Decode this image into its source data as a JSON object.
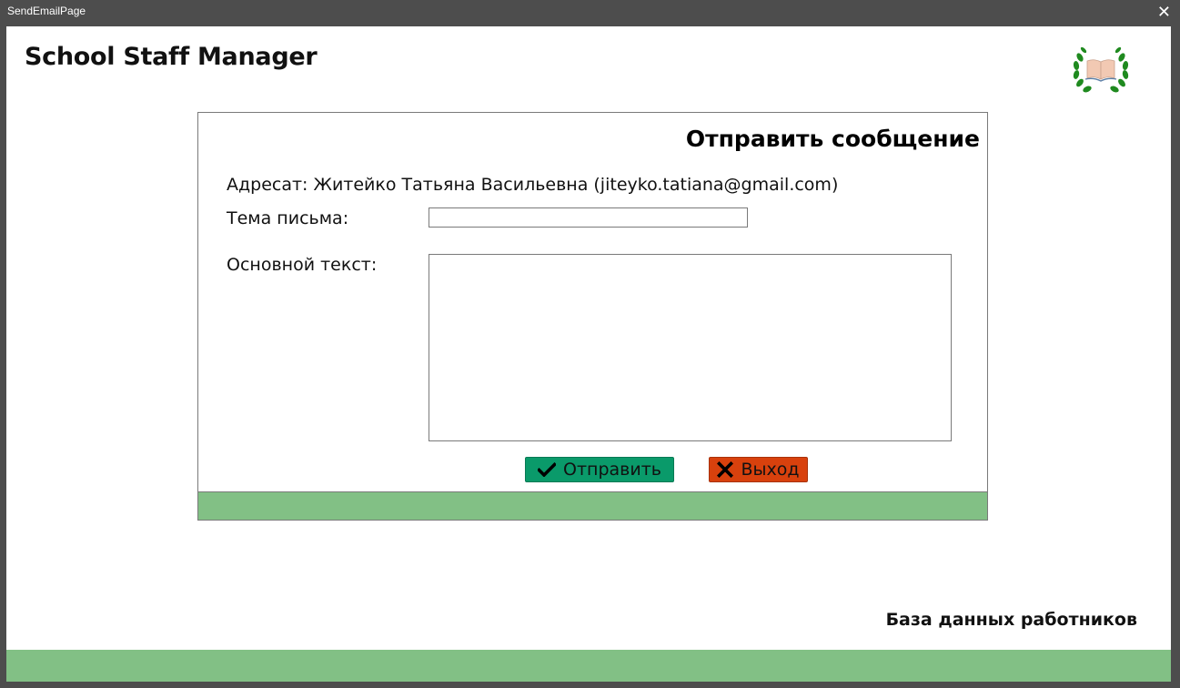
{
  "titlebar": {
    "title": "SendEmailPage",
    "close_label": "✕"
  },
  "app": {
    "title": "School Staff Manager",
    "footer_label": "База данных работников"
  },
  "form": {
    "heading": "Отправить сообщение",
    "recipient": "Адресат: Житейко Татьяна Васильевна (jiteyko.tatiana@gmail.com)",
    "subject_label": "Тема письма:",
    "subject_value": "",
    "body_label": "Основной текст:",
    "body_value": "",
    "send_label": "Отправить",
    "exit_label": "Выход"
  },
  "colors": {
    "accent_green": "#82c085",
    "send_button": "#0a9a6a",
    "exit_button": "#d8410d",
    "titlebar": "#4d4d4d"
  },
  "icons": {
    "logo": "laurel-book-icon",
    "send": "check-icon",
    "exit": "x-icon",
    "close": "close-icon"
  }
}
